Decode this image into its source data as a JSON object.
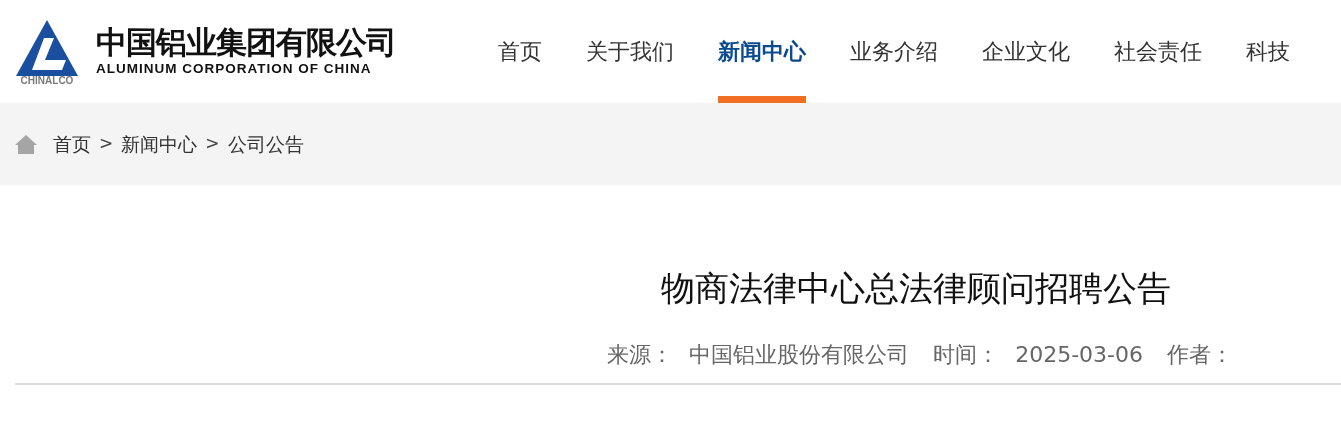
{
  "logo": {
    "abbr": "CHINALCO",
    "name_cn": "中国铝业集团有限公司",
    "name_en": "ALUMINUM CORPORATION OF CHINA"
  },
  "nav": [
    {
      "label": "首页",
      "selected": false
    },
    {
      "label": "关于我们",
      "selected": false
    },
    {
      "label": "新闻中心",
      "selected": true
    },
    {
      "label": "业务介绍",
      "selected": false
    },
    {
      "label": "企业文化",
      "selected": false
    },
    {
      "label": "社会责任",
      "selected": false
    },
    {
      "label": "科技",
      "selected": false
    }
  ],
  "breadcrumb": [
    {
      "kind": "link",
      "text": "首页"
    },
    {
      "kind": "separator",
      "text": ">"
    },
    {
      "kind": "link",
      "text": "新闻中心"
    },
    {
      "kind": "separator",
      "text": ">"
    },
    {
      "kind": "link",
      "text": "公司公告"
    }
  ],
  "article": {
    "title": "物商法律中心总法律顾问招聘公告",
    "meta": [
      {
        "label": "来源：",
        "value": "中国铝业股份有限公司"
      },
      {
        "label": "时间：",
        "value": "2025-03-06"
      },
      {
        "label": "作者："
      }
    ]
  }
}
